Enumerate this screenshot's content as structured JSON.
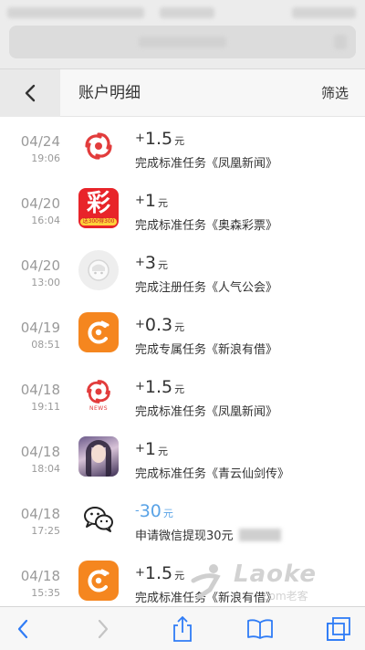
{
  "header": {
    "title": "账户明细",
    "filter_label": "筛选"
  },
  "records": [
    {
      "date": "04/24",
      "time": "19:06",
      "sign": "+",
      "amount": "1.5",
      "unit": "元",
      "desc": "完成标准任务《凤凰新闻》",
      "icon": "phoenix-news-icon"
    },
    {
      "date": "04/20",
      "time": "16:04",
      "sign": "+",
      "amount": "1",
      "unit": "元",
      "desc": "完成标准任务《奥森彩票》",
      "icon": "lottery-app-icon",
      "icon_text": "彩",
      "icon_badge": "送300得300"
    },
    {
      "date": "04/20",
      "time": "13:00",
      "sign": "+",
      "amount": "3",
      "unit": "元",
      "desc": "完成注册任务《人气公会》",
      "icon": "guild-app-icon"
    },
    {
      "date": "04/19",
      "time": "08:51",
      "sign": "+",
      "amount": "0.3",
      "unit": "元",
      "desc": "完成专属任务《新浪有借》",
      "icon": "sina-loan-icon"
    },
    {
      "date": "04/18",
      "time": "19:11",
      "sign": "+",
      "amount": "1.5",
      "unit": "元",
      "desc": "完成标准任务《凤凰新闻》",
      "icon": "phoenix-news-icon",
      "icon_caption": "NEWS"
    },
    {
      "date": "04/18",
      "time": "18:04",
      "sign": "+",
      "amount": "1",
      "unit": "元",
      "desc": "完成标准任务《青云仙剑传》",
      "icon": "game-app-icon"
    },
    {
      "date": "04/18",
      "time": "17:25",
      "sign": "-",
      "amount": "30",
      "unit": "元",
      "desc": "申请微信提现30元",
      "icon": "wechat-icon"
    },
    {
      "date": "04/18",
      "time": "15:35",
      "sign": "+",
      "amount": "1.5",
      "unit": "元",
      "desc": "完成标准任务《新浪有借》",
      "icon": "sina-loan-icon"
    }
  ],
  "watermark": {
    "text": "Laoke",
    "sub": "com老客"
  },
  "colors": {
    "negative_amount": "#5aa3e6",
    "phoenix_red": "#e23c3c",
    "orange_icon": "#f5861f",
    "lottery_red": "#e8242a"
  },
  "toolbar": {
    "items": [
      "back-arrow-icon",
      "forward-arrow-icon",
      "share-icon",
      "bookmarks-icon",
      "tabs-icon"
    ]
  }
}
